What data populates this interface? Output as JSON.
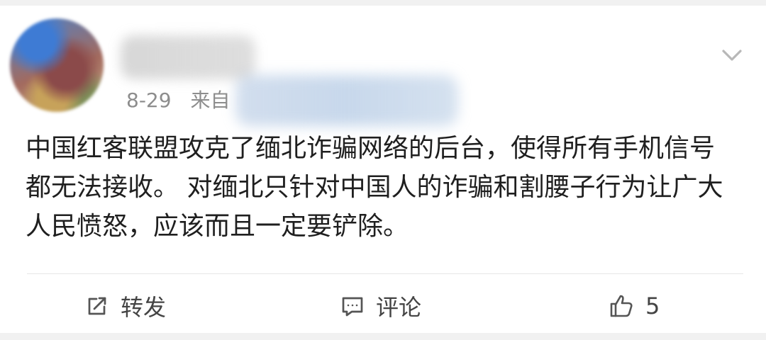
{
  "post": {
    "date": "8-29",
    "source_prefix": "来自",
    "content": "中国红客联盟攻克了缅北诈骗网络的后台，使得所有手机信号都无法接收。 对缅北只针对中国人的诈骗和割腰子行为让广大人民愤怒，应该而且一定要铲除。"
  },
  "actions": {
    "repost_label": "转发",
    "comment_label": "评论",
    "like_count": "5"
  },
  "icons": {
    "expand": "chevron-down-icon",
    "repost": "share-icon",
    "comment": "comment-icon",
    "like": "thumbs-up-icon"
  }
}
